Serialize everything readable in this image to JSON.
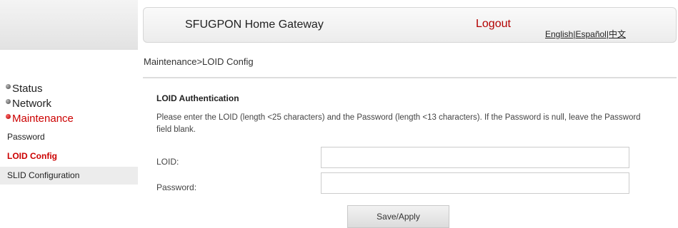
{
  "header": {
    "title": "SFUGPON Home Gateway",
    "logout": "Logout",
    "languages": [
      "English",
      "Español",
      "中文"
    ],
    "lang_separator": "|"
  },
  "breadcrumb": "Maintenance>LOID Config",
  "sidebar": {
    "main_items": [
      {
        "label": "Status"
      },
      {
        "label": "Network"
      },
      {
        "label": "Maintenance"
      }
    ],
    "sub_items": [
      {
        "label": "Password"
      },
      {
        "label": "LOID Config"
      },
      {
        "label": "SLID Configuration"
      }
    ],
    "active_color": "#cc0000"
  },
  "content": {
    "section_title": "LOID Authentication",
    "description": "Please enter the LOID (length <25 characters) and the Password (length <13 characters). If the Password is null, leave the Password field blank.",
    "fields": [
      {
        "label": "LOID:",
        "value": ""
      },
      {
        "label": "Password:",
        "value": ""
      }
    ],
    "save_button": "Save/Apply"
  }
}
